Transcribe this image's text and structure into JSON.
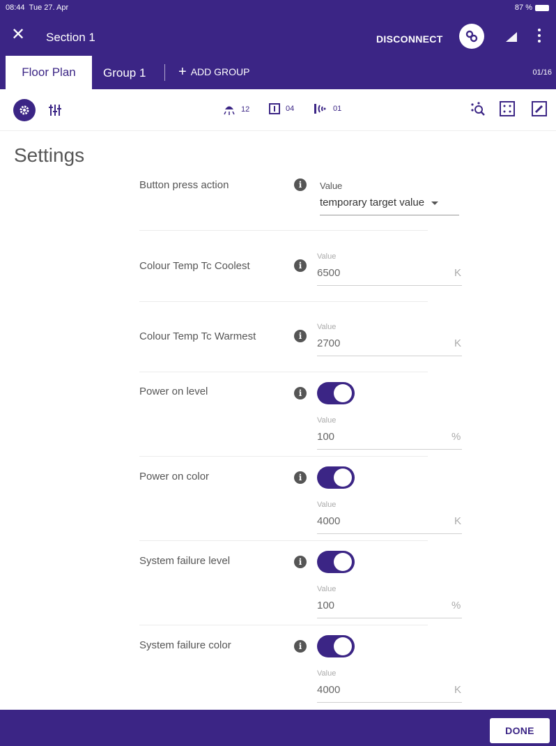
{
  "status_bar": {
    "time": "08:44",
    "date": "Tue 27. Apr",
    "battery": "87 %"
  },
  "app_bar": {
    "title": "Section 1",
    "disconnect_label": "DISCONNECT"
  },
  "tabs": {
    "active": "Floor Plan",
    "group": "Group 1",
    "add_group": "ADD GROUP",
    "page_count": "01/16"
  },
  "toolbar": {
    "luminaire_count": "12",
    "sensor_count": "04",
    "beacon_count": "01"
  },
  "page_title": "Settings",
  "settings": {
    "button_press": {
      "label": "Button press action",
      "field_label": "Value",
      "selected": "temporary target value"
    },
    "tc_coolest": {
      "label": "Colour Temp Tc Coolest",
      "field_label": "Value",
      "value": "6500",
      "unit": "K"
    },
    "tc_warmest": {
      "label": "Colour Temp Tc Warmest",
      "field_label": "Value",
      "value": "2700",
      "unit": "K"
    },
    "power_on_level": {
      "label": "Power on level",
      "field_label": "Value",
      "value": "100",
      "unit": "%",
      "enabled": true
    },
    "power_on_color": {
      "label": "Power on color",
      "field_label": "Value",
      "value": "4000",
      "unit": "K",
      "enabled": true
    },
    "sys_fail_level": {
      "label": "System failure level",
      "field_label": "Value",
      "value": "100",
      "unit": "%",
      "enabled": true
    },
    "sys_fail_color": {
      "label": "System failure color",
      "field_label": "Value",
      "value": "4000",
      "unit": "K",
      "enabled": true
    }
  },
  "footer": {
    "done_label": "DONE"
  },
  "colors": {
    "primary": "#3b2585",
    "background": "#ffffff"
  }
}
